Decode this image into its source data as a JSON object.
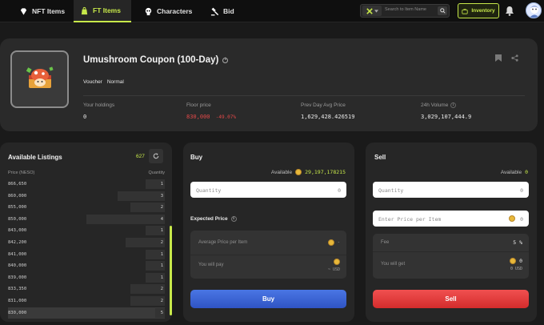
{
  "nav": {
    "tabs": [
      {
        "label": "NFT Items",
        "icon": "diamond-icon"
      },
      {
        "label": "FT Items",
        "icon": "bag-icon"
      },
      {
        "label": "Characters",
        "icon": "skull-icon"
      },
      {
        "label": "Bid",
        "icon": "gavel-icon"
      }
    ],
    "active_tab": "FT Items",
    "search_placeholder": "Search to Item Name",
    "inventory_label": "Inventory",
    "accent": "#c7e84a"
  },
  "item": {
    "title": "Umushroom Coupon (100-Day)",
    "tags": [
      "Voucher",
      "Normal"
    ],
    "stats": [
      {
        "label": "Your holdings",
        "value": "0"
      },
      {
        "label": "Floor price",
        "value": "830,000",
        "change": "-49.07%"
      },
      {
        "label": "Prev Day Avg Price",
        "value": "1,629,428.426519"
      },
      {
        "label": "24h Volume",
        "value": "3,029,107,444.9"
      }
    ]
  },
  "listings": {
    "title": "Available Listings",
    "count": "627",
    "col_price": "Price (NESO)",
    "col_qty": "Quantity",
    "rows": [
      {
        "price": "866,650",
        "qty": "1",
        "depth": 0.12
      },
      {
        "price": "860,000",
        "qty": "3",
        "depth": 0.3
      },
      {
        "price": "855,000",
        "qty": "2",
        "depth": 0.22
      },
      {
        "price": "850,000",
        "qty": "4",
        "depth": 0.5
      },
      {
        "price": "843,000",
        "qty": "1",
        "depth": 0.12
      },
      {
        "price": "842,200",
        "qty": "2",
        "depth": 0.25
      },
      {
        "price": "841,000",
        "qty": "1",
        "depth": 0.12
      },
      {
        "price": "840,000",
        "qty": "1",
        "depth": 0.12
      },
      {
        "price": "839,000",
        "qty": "1",
        "depth": 0.12
      },
      {
        "price": "833,350",
        "qty": "2",
        "depth": 0.22
      },
      {
        "price": "831,000",
        "qty": "2",
        "depth": 0.22
      },
      {
        "price": "830,000",
        "qty": "5",
        "depth": 0.06
      }
    ]
  },
  "buy": {
    "title": "Buy",
    "available_label": "Available",
    "available_value": "29,197,178215",
    "quantity_placeholder": "Quantity",
    "quantity_value": "0",
    "expected_price_label": "Expected Price",
    "avg_price_label": "Average Price per Item",
    "avg_price_value": "-",
    "you_will_pay_label": "You will pay",
    "pay_usd": "~ USD",
    "button": "Buy",
    "button_color": "#3a62d4"
  },
  "sell": {
    "title": "Sell",
    "available_label": "Available",
    "available_value": "0",
    "quantity_placeholder": "Quantity",
    "quantity_value": "0",
    "price_placeholder": "Enter Price per Item",
    "price_value": "0",
    "fee_label": "Fee",
    "fee_value": "5 %",
    "you_will_get_label": "You will get",
    "get_value": "0",
    "get_usd": "0 USD",
    "button": "Sell",
    "button_color": "#e43a3a"
  }
}
